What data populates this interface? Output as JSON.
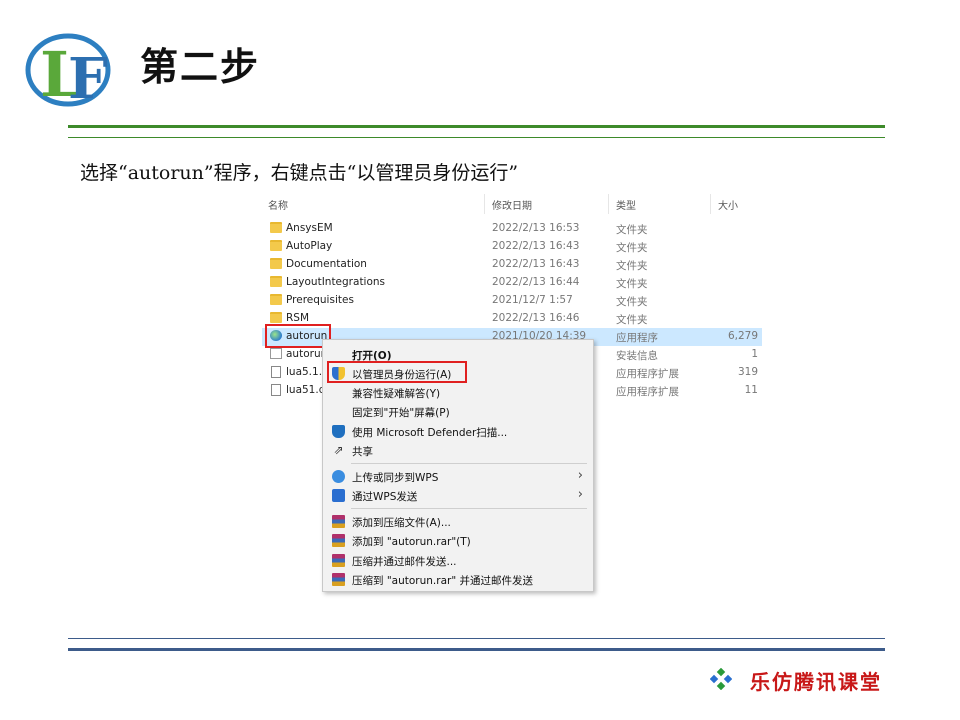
{
  "slide": {
    "title": "第二步",
    "instruction": "选择“autorun”程序，右键点击“以管理员身份运行”",
    "logo_letters": "LF",
    "brand_text": "乐仿腾讯课堂"
  },
  "explorer": {
    "columns": {
      "name": "名称",
      "date": "修改日期",
      "type": "类型",
      "size": "大小"
    },
    "rows": [
      {
        "name": "AnsysEM",
        "date": "2022/2/13 16:53",
        "type": "文件夹",
        "size": "",
        "icon": "folder-icon"
      },
      {
        "name": "AutoPlay",
        "date": "2022/2/13 16:43",
        "type": "文件夹",
        "size": "",
        "icon": "folder-icon"
      },
      {
        "name": "Documentation",
        "date": "2022/2/13 16:43",
        "type": "文件夹",
        "size": "",
        "icon": "folder-icon"
      },
      {
        "name": "LayoutIntegrations",
        "date": "2022/2/13 16:44",
        "type": "文件夹",
        "size": "",
        "icon": "folder-icon"
      },
      {
        "name": "Prerequisites",
        "date": "2021/12/7 1:57",
        "type": "文件夹",
        "size": "",
        "icon": "folder-icon"
      },
      {
        "name": "RSM",
        "date": "2022/2/13 16:46",
        "type": "文件夹",
        "size": "",
        "icon": "folder-icon"
      },
      {
        "name": "autorun",
        "date": "2021/10/20 14:39",
        "type": "应用程序",
        "size": "6,279",
        "icon": "app-icon",
        "selected": true
      },
      {
        "name": "autorun",
        "date": "",
        "type": "安装信息",
        "size": "1",
        "icon": "info-icon"
      },
      {
        "name": "lua5.1.d",
        "date": "",
        "type": "应用程序扩展",
        "size": "319",
        "icon": "file-icon"
      },
      {
        "name": "lua51.d",
        "date": "",
        "type": "应用程序扩展",
        "size": "11",
        "icon": "file-icon"
      }
    ]
  },
  "context_menu": {
    "items": [
      {
        "label": "打开(O)",
        "icon": "",
        "bold": true
      },
      {
        "label": "以管理员身份运行(A)",
        "icon": "shield-icon"
      },
      {
        "label": "兼容性疑难解答(Y)",
        "icon": ""
      },
      {
        "label": "固定到\"开始\"屏幕(P)",
        "icon": ""
      },
      {
        "label": "使用 Microsoft Defender扫描...",
        "icon": "defender-icon"
      },
      {
        "label": "共享",
        "icon": "share-icon"
      },
      {
        "label": "上传或同步到WPS",
        "icon": "wps-up-icon",
        "submenu": true
      },
      {
        "label": "通过WPS发送",
        "icon": "wps-send-icon",
        "submenu": true
      },
      {
        "label": "添加到压缩文件(A)...",
        "icon": "rar-icon"
      },
      {
        "label": "添加到 \"autorun.rar\"(T)",
        "icon": "rar-icon"
      },
      {
        "label": "压缩并通过邮件发送...",
        "icon": "rar-icon"
      },
      {
        "label": "压缩到 \"autorun.rar\" 并通过邮件发送",
        "icon": "rar-icon"
      }
    ]
  },
  "colors": {
    "rule_top": "#3d8a2a",
    "rule_bottom": "#3d5b8a",
    "highlight_box": "#e02020",
    "brand_red": "#c81818",
    "selection": "#cce8ff"
  }
}
